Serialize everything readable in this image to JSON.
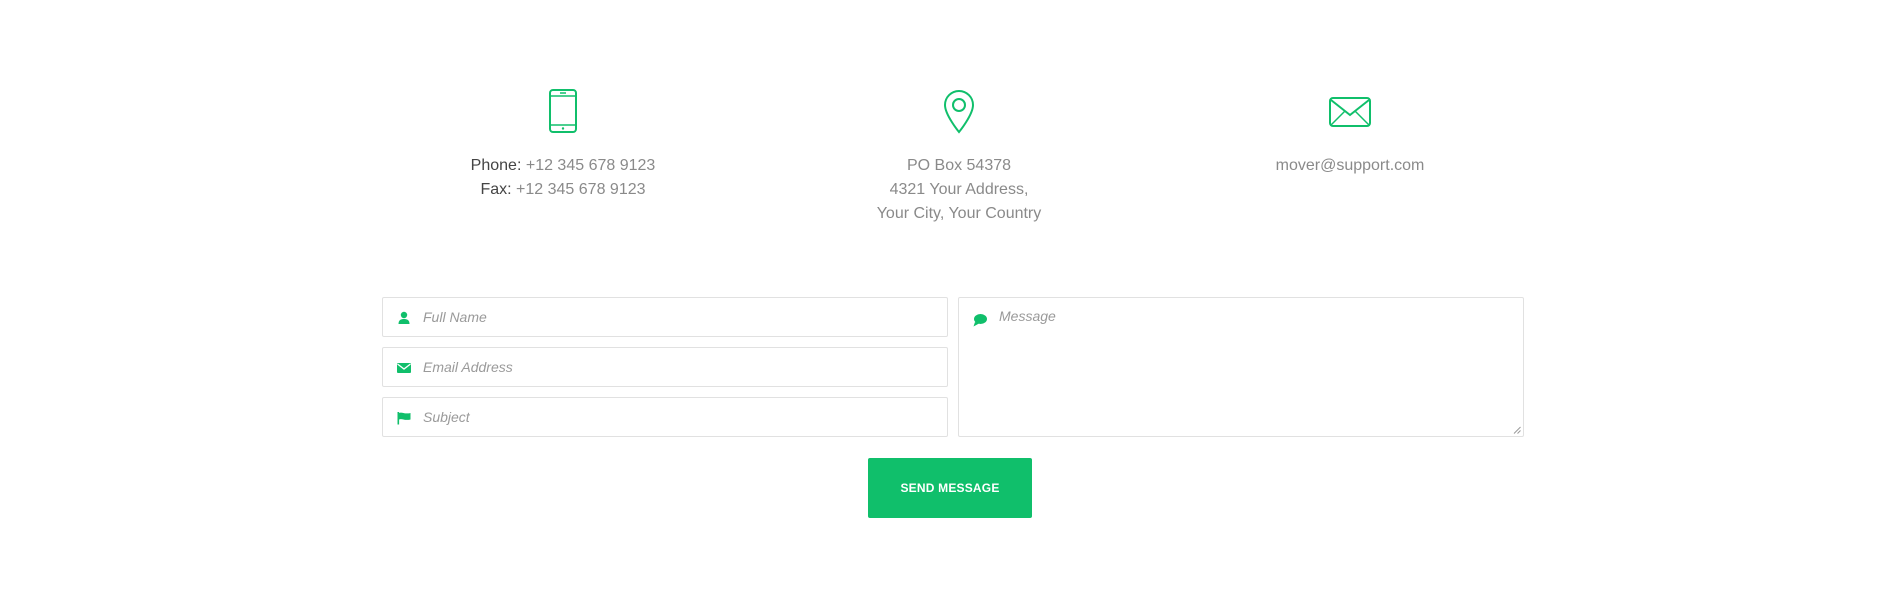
{
  "contact": {
    "phone": {
      "icon": "tablet-icon",
      "label": "Phone:",
      "value": "+12 345 678 9123"
    },
    "fax": {
      "label": "Fax:",
      "value": "+12 345 678 9123"
    },
    "address": {
      "icon": "map-pin-icon",
      "lines": [
        "PO Box 54378",
        "4321 Your Address,",
        "Your City, Your Country"
      ]
    },
    "email": {
      "icon": "envelope-icon",
      "value": "mover@support.com"
    }
  },
  "form": {
    "name_placeholder": "Full Name",
    "email_placeholder": "Email Address",
    "subject_placeholder": "Subject",
    "message_placeholder": "Message",
    "submit_label": "SEND MESSAGE"
  },
  "colors": {
    "accent": "#10bf6b",
    "text": "#8a8a8a",
    "label": "#444444",
    "border": "#e1e1e1"
  }
}
